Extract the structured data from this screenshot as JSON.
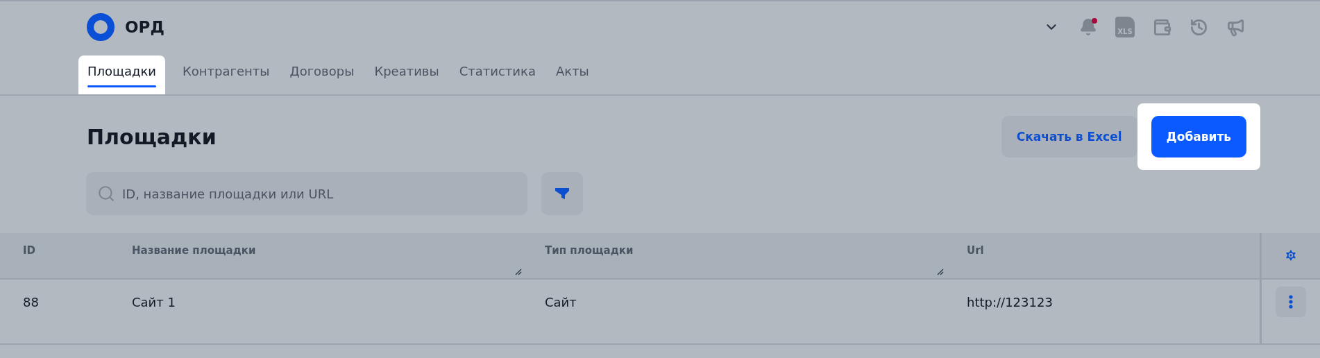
{
  "header": {
    "logo_text": "ОРД",
    "notification_dot": true,
    "xls_label": "XLS"
  },
  "tabs": [
    {
      "label": "Площадки",
      "selected": true
    },
    {
      "label": "Контрагенты",
      "selected": false
    },
    {
      "label": "Договоры",
      "selected": false
    },
    {
      "label": "Креативы",
      "selected": false
    },
    {
      "label": "Статистика",
      "selected": false
    },
    {
      "label": "Акты",
      "selected": false
    }
  ],
  "page": {
    "title": "Площадки",
    "buttons": [
      {
        "label": "Скачать в Excel",
        "kind": "secondary"
      },
      {
        "label": "Добавить",
        "kind": "primary"
      }
    ]
  },
  "search": {
    "placeholder": "ID, название площадки или URL"
  },
  "table": {
    "columns": [
      {
        "label": "ID",
        "resizable": false
      },
      {
        "label": "Название площадки",
        "resizable": true
      },
      {
        "label": "Тип площадки",
        "resizable": true
      },
      {
        "label": "Url",
        "resizable": false
      }
    ],
    "rows": [
      [
        "88",
        "Сайт 1",
        "Сайт",
        "http://123123"
      ]
    ]
  }
}
